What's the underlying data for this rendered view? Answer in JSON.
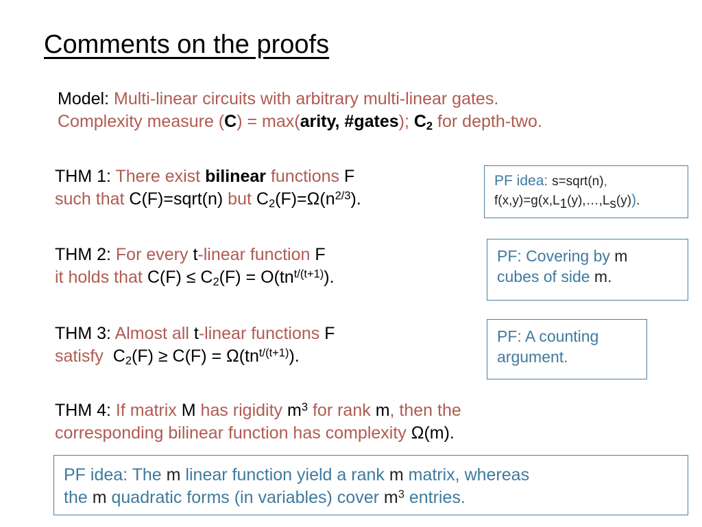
{
  "slide": {
    "title": "Comments on the proofs",
    "model": {
      "line1_label": "Model:",
      "line1_text": "Multi-linear circuits with arbitrary multi-linear gates.",
      "line2_pre": "Complexity measure (",
      "line2_c": "C",
      "line2_mid": ") = max(",
      "line2_bold": "arity, #gates",
      "line2_post": "); ",
      "line2_c2": "C",
      "line2_c2_sub": "2",
      "line2_end": " for depth-two."
    },
    "thm1": {
      "label": "THM 1:",
      "red1": "There exist",
      "bold": "bilinear",
      "red2": "functions",
      "var": "F",
      "red3": "such that",
      "body1": "C(F)=sqrt(n)",
      "red4": "but",
      "body2": "C",
      "body2_sub": "2",
      "body3": "(F)=",
      "omega": "Ω",
      "body4": "(n",
      "exp": "2/3",
      "body5": ")."
    },
    "thm2": {
      "label": "THM 2:",
      "red1": "For every",
      "t": "t",
      "red2": "-linear function",
      "var": "F",
      "red3": "it holds that",
      "body1": "C(F) ≤ C",
      "body1_sub": "2",
      "body2": "(F) = O(tn",
      "exp": "t/(t+1)",
      "body3": ")."
    },
    "thm3": {
      "label": "THM 3:",
      "red1": "Almost all",
      "t": "t",
      "red2": "-linear functions",
      "var": "F",
      "red3": "satisfy",
      "body1": "C",
      "body1_sub": "2",
      "body2": "(F) ≥ C(F) = ",
      "omega": "Ω",
      "body3": "(tn",
      "exp": "t/(t+1)",
      "body4": ")."
    },
    "thm4": {
      "label": "THM 4:",
      "red1": "If matrix",
      "m1": "M",
      "red2": "has rigidity",
      "m2": "m",
      "m2_exp": "3",
      "red3": "for rank",
      "m3": "m",
      "red4": ", then the",
      "red5": "corresponding bilinear function has complexity",
      "omega": "Ω",
      "end": "(m)."
    },
    "pf1": {
      "lead": "PF idea:",
      "dark1": "s=sqrt(n)",
      "blue1": ",",
      "dark2": "f(x,y)=g(x,L",
      "sub1": "1",
      "dark3": "(y),…,L",
      "sub_s": "s",
      "dark4": "(y)",
      "blue2": ")",
      "dark5": "."
    },
    "pf2": {
      "lead": "PF:",
      "text1": "Covering by",
      "m1": "m",
      "text2": "cubes of side",
      "m2": "m",
      "dot": "."
    },
    "pf3": {
      "lead": "PF:",
      "text1": "A counting",
      "text2": "argument."
    },
    "pf4": {
      "lead": "PF idea:",
      "text1": "The",
      "m1": "m",
      "text2": "linear function yield a rank",
      "m2": "m",
      "text3": "matrix, whereas",
      "text4": "the",
      "m3": "m",
      "text5": "quadratic forms (in variables) cover",
      "m4": "m",
      "m4_exp": "3",
      "text6": "entries."
    }
  },
  "colors": {
    "red": "#b05b52",
    "blue": "#3e7a9e",
    "box_border": "#4a7fa5",
    "black": "#000000"
  }
}
